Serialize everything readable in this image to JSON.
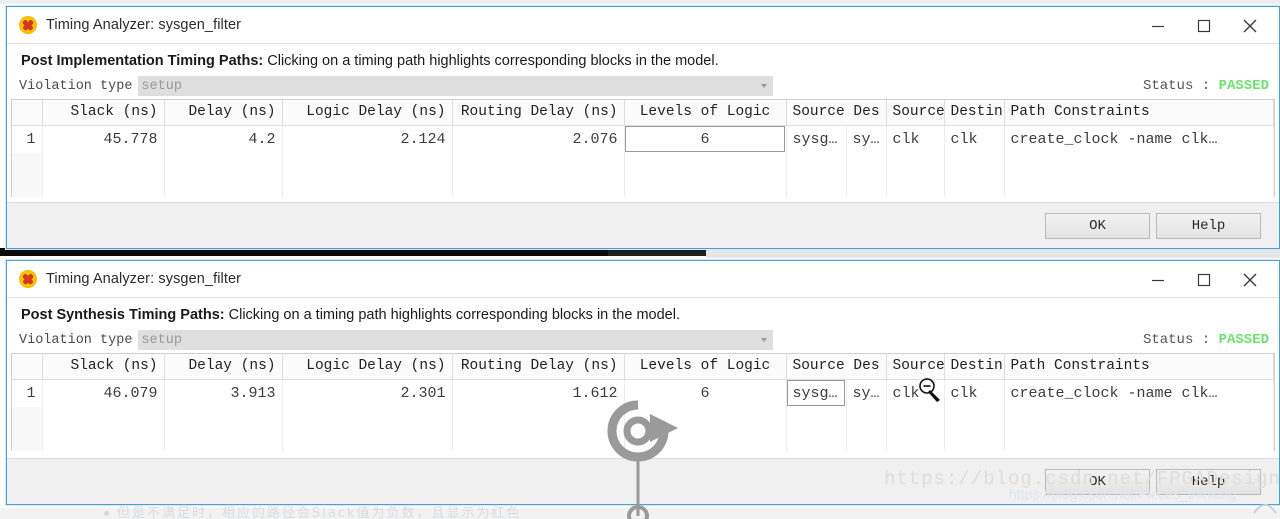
{
  "app": {
    "icon": "xilinx-app-icon",
    "title": "Timing Analyzer: sysgen_filter"
  },
  "window_controls": {
    "minimize": "minimize-icon",
    "maximize": "maximize-icon",
    "close": "close-icon"
  },
  "windows": [
    {
      "title": "Timing Analyzer: sysgen_filter",
      "desc_bold": "Post Implementation Timing Paths:",
      "desc_rest": " Clicking on a timing path highlights corresponding blocks in the model.",
      "violation": {
        "label": "Violation type",
        "value": "setup"
      },
      "status": {
        "label": "Status :",
        "value": "PASSED",
        "color": "#6ee06e"
      },
      "table": {
        "columns": [
          "",
          "Slack (ns)",
          "Delay (ns)",
          "Logic Delay (ns)",
          "Routing Delay (ns)",
          "Levels of Logic",
          "Source Des",
          "Source",
          "Destin",
          "Path Constraints"
        ],
        "rows": [
          {
            "num": "1",
            "slack": "45.778",
            "delay": "4.2",
            "logic_delay": "2.124",
            "routing_delay": "2.076",
            "levels_of_logic": "6",
            "source_des": "sysg…",
            "source": "sy…",
            "source_clk": "clk",
            "dest_clk": "clk",
            "path_constraints": "create_clock -name clk…"
          }
        ],
        "selected_cell": "levels_of_logic"
      },
      "buttons": {
        "ok": "OK",
        "help": "Help"
      }
    },
    {
      "title": "Timing Analyzer: sysgen_filter",
      "desc_bold": "Post Synthesis Timing Paths:",
      "desc_rest": " Clicking on a timing path highlights corresponding blocks in the model.",
      "violation": {
        "label": "Violation type",
        "value": "setup"
      },
      "status": {
        "label": "Status :",
        "value": "PASSED",
        "color": "#6ee06e"
      },
      "table": {
        "columns": [
          "",
          "Slack (ns)",
          "Delay (ns)",
          "Logic Delay (ns)",
          "Routing Delay (ns)",
          "Levels of Logic",
          "Source Des",
          "Source",
          "Destin",
          "Path Constraints"
        ],
        "rows": [
          {
            "num": "1",
            "slack": "46.079",
            "delay": "3.913",
            "logic_delay": "2.301",
            "routing_delay": "1.612",
            "levels_of_logic": "6",
            "source_des": "sysg…",
            "source": "sy…",
            "source_clk": "clk",
            "dest_clk": "clk",
            "path_constraints": "create_clock -name clk…"
          }
        ],
        "selected_cell": "source_des"
      },
      "buttons": {
        "ok": "OK",
        "help": "Help"
      }
    }
  ],
  "overlays": {
    "annotation_icon": "rotate-arrow-icon",
    "cursor_icon": "zoom-out-magnifier-cursor",
    "watermark_large": "https://blog.csdn.net/FPGADesigner",
    "watermark_small": "https://blog.csdn.net/Pieces_thinking",
    "bottom_note": "但是不满足时，相应的路径会Slack值为负数，且显示为红色"
  }
}
